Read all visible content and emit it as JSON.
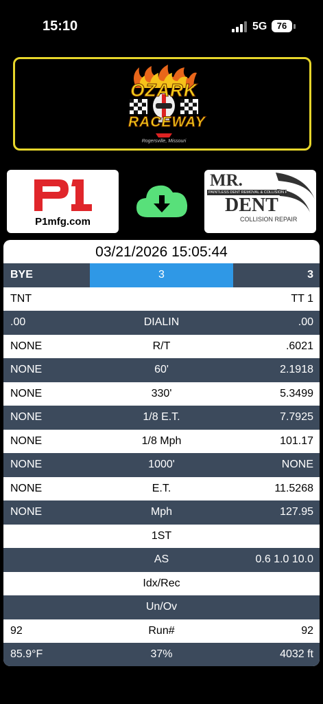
{
  "status_bar": {
    "time": "15:10",
    "network": "5G",
    "battery": "76"
  },
  "banner": {
    "logo_line1": "OZARK",
    "logo_line2": "RACEWAY",
    "logo_town": "Rogersville, Missouri"
  },
  "sponsors": {
    "left": {
      "logo_text": "P1",
      "site": "P1mfg.com"
    },
    "right": {
      "mr": "MR.",
      "tagline": "PAINTLESS DENT REMOVAL & COLLISION REPAIR",
      "dent": "DENT",
      "sub": "COLLISION REPAIR"
    }
  },
  "download": {
    "icon": "cloud-download-icon",
    "color": "#58e07a"
  },
  "results": {
    "timestamp": "03/21/2026 15:05:44",
    "rows": [
      {
        "left": "BYE",
        "mid": "3",
        "right": "3"
      },
      {
        "left": "TNT",
        "mid": "",
        "right": "TT 1"
      },
      {
        "left": ".00",
        "mid": "DIALIN",
        "right": ".00"
      },
      {
        "left": "NONE",
        "mid": "R/T",
        "right": ".6021"
      },
      {
        "left": "NONE",
        "mid": "60'",
        "right": "2.1918"
      },
      {
        "left": "NONE",
        "mid": "330'",
        "right": "5.3499"
      },
      {
        "left": "NONE",
        "mid": "1/8 E.T.",
        "right": "7.7925"
      },
      {
        "left": "NONE",
        "mid": "1/8 Mph",
        "right": "101.17"
      },
      {
        "left": "NONE",
        "mid": "1000'",
        "right": "NONE"
      },
      {
        "left": "NONE",
        "mid": "E.T.",
        "right": "11.5268"
      },
      {
        "left": "NONE",
        "mid": "Mph",
        "right": "127.95"
      },
      {
        "left": "",
        "mid": "1ST",
        "right": ""
      },
      {
        "left": "",
        "mid": "AS",
        "right": "0.6 1.0 10.0"
      },
      {
        "left": "",
        "mid": "Idx/Rec",
        "right": ""
      },
      {
        "left": "",
        "mid": "Un/Ov",
        "right": ""
      },
      {
        "left": "92",
        "mid": "Run#",
        "right": "92"
      },
      {
        "left": "85.9°F",
        "mid": "37%",
        "right": "4032 ft"
      }
    ]
  },
  "colors": {
    "row_dark": "#3c4a5c",
    "header_highlight": "#2f98e6",
    "banner_border": "#e7d62b"
  }
}
